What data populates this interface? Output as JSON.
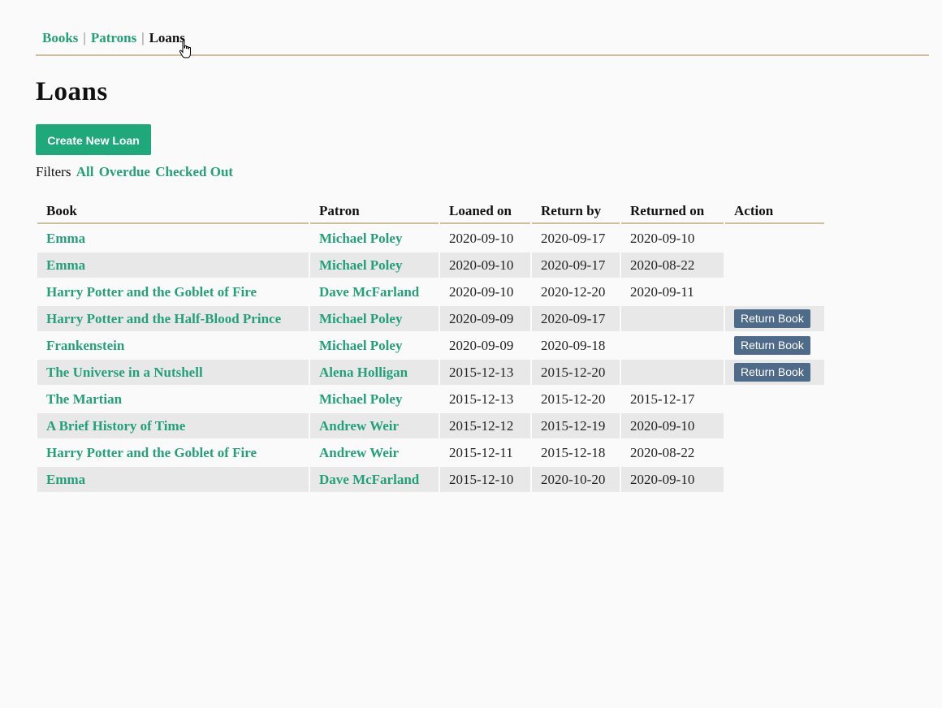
{
  "nav": {
    "books": "Books",
    "patrons": "Patrons",
    "loans": "Loans",
    "separator": "|"
  },
  "page_title": "Loans",
  "create_button": "Create New Loan",
  "filters": {
    "label": "Filters",
    "options": [
      "All",
      "Overdue",
      "Checked Out"
    ]
  },
  "table": {
    "headers": [
      "Book",
      "Patron",
      "Loaned on",
      "Return by",
      "Returned on",
      "Action"
    ],
    "rows": [
      {
        "book": "Emma",
        "patron": "Michael Poley",
        "loaned_on": "2020-09-10",
        "return_by": "2020-09-17",
        "returned_on": "2020-09-10",
        "action": ""
      },
      {
        "book": "Emma",
        "patron": "Michael Poley",
        "loaned_on": "2020-09-10",
        "return_by": "2020-09-17",
        "returned_on": "2020-08-22",
        "action": ""
      },
      {
        "book": "Harry Potter and the Goblet of Fire",
        "patron": "Dave McFarland",
        "loaned_on": "2020-09-10",
        "return_by": "2020-12-20",
        "returned_on": "2020-09-11",
        "action": ""
      },
      {
        "book": "Harry Potter and the Half-Blood Prince",
        "patron": "Michael Poley",
        "loaned_on": "2020-09-09",
        "return_by": "2020-09-17",
        "returned_on": "",
        "action": "Return Book"
      },
      {
        "book": "Frankenstein",
        "patron": "Michael Poley",
        "loaned_on": "2020-09-09",
        "return_by": "2020-09-18",
        "returned_on": "",
        "action": "Return Book"
      },
      {
        "book": "The Universe in a Nutshell",
        "patron": "Alena Holligan",
        "loaned_on": "2015-12-13",
        "return_by": "2015-12-20",
        "returned_on": "",
        "action": "Return Book"
      },
      {
        "book": "The Martian",
        "patron": "Michael Poley",
        "loaned_on": "2015-12-13",
        "return_by": "2015-12-20",
        "returned_on": "2015-12-17",
        "action": ""
      },
      {
        "book": "A Brief History of Time",
        "patron": "Andrew Weir",
        "loaned_on": "2015-12-12",
        "return_by": "2015-12-19",
        "returned_on": "2020-09-10",
        "action": ""
      },
      {
        "book": "Harry Potter and the Goblet of Fire",
        "patron": "Andrew Weir",
        "loaned_on": "2015-12-11",
        "return_by": "2015-12-18",
        "returned_on": "2020-08-22",
        "action": ""
      },
      {
        "book": "Emma",
        "patron": "Dave McFarland",
        "loaned_on": "2015-12-10",
        "return_by": "2020-10-20",
        "returned_on": "2020-09-10",
        "action": ""
      }
    ]
  },
  "cursor": "hand-pointer-icon",
  "colors": {
    "link": "#23a07a",
    "create_button": "#1fa87a",
    "return_button": "#4f6b8a",
    "rule": "#cdbf9e",
    "alt_row": "#e8e8e8"
  }
}
